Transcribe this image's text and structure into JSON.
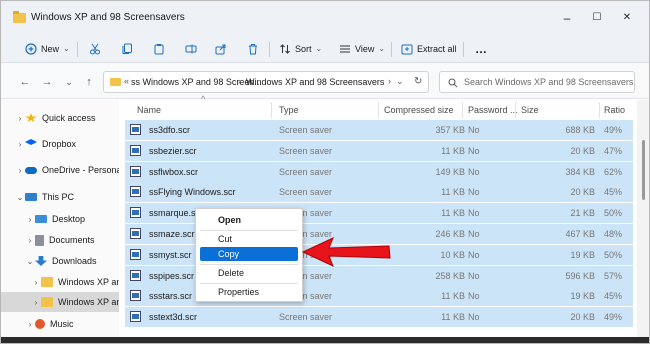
{
  "window": {
    "title": "Windows XP and 98 Screensavers"
  },
  "window_controls": {
    "minimize": "–",
    "maximize": "☐",
    "close": "✕"
  },
  "toolbar": {
    "new_label": "New",
    "sort_label": "Sort",
    "view_label": "View",
    "extract_label": "Extract all",
    "more_label": "…",
    "dropdown_glyph": "⌄"
  },
  "nav": {
    "back": "←",
    "forward": "→",
    "recent": "⌄",
    "up": "↑"
  },
  "addressbar": {
    "overflow": "«",
    "segments": [
      "ss Windows XP and 98 Screen...",
      "Windows XP and 98 Screensavers"
    ],
    "separator": "›",
    "dropdown": "⌄",
    "refresh": "↻"
  },
  "search": {
    "placeholder": "Search Windows XP and 98 Screensavers"
  },
  "sidebar": {
    "items": [
      {
        "label": "Quick access",
        "chevron": "›",
        "icon": "star-icon",
        "color": "#f2b705"
      },
      {
        "label": "Dropbox",
        "chevron": "›",
        "icon": "dropbox-icon",
        "color": "#0061fe"
      },
      {
        "label": "OneDrive - Personal",
        "chevron": "›",
        "icon": "cloud-icon",
        "color": "#0f6cbd"
      },
      {
        "label": "This PC",
        "chevron": "⌄",
        "icon": "computer-icon",
        "color": "#2f7fd1"
      },
      {
        "label": "Desktop",
        "chevron": "›",
        "icon": "desktop-icon",
        "color": "#3b8fd8"
      },
      {
        "label": "Documents",
        "chevron": "›",
        "icon": "documents-icon",
        "color": "#8a8f98"
      },
      {
        "label": "Downloads",
        "chevron": "⌄",
        "icon": "downloads-icon",
        "color": "#2a7bd0"
      },
      {
        "label": "Windows XP and",
        "chevron": "›",
        "icon": "folder-icon",
        "color": "#f3c24a"
      },
      {
        "label": "Windows XP and",
        "chevron": "›",
        "icon": "folder-icon",
        "color": "#f3c24a"
      },
      {
        "label": "Music",
        "chevron": "›",
        "icon": "music-icon",
        "color": "#e05a2b"
      }
    ]
  },
  "table": {
    "sort_glyph": "^",
    "headers": [
      "Name",
      "Type",
      "Compressed size",
      "Password ...",
      "Size",
      "Ratio"
    ],
    "rows": [
      {
        "name": "ss3dfo.scr",
        "type": "Screen saver",
        "compressed": "357 KB",
        "password": "No",
        "size": "688 KB",
        "ratio": "49%"
      },
      {
        "name": "ssbezier.scr",
        "type": "Screen saver",
        "compressed": "11 KB",
        "password": "No",
        "size": "20 KB",
        "ratio": "47%"
      },
      {
        "name": "ssflwbox.scr",
        "type": "Screen saver",
        "compressed": "149 KB",
        "password": "No",
        "size": "384 KB",
        "ratio": "62%"
      },
      {
        "name": "ssFlying Windows.scr",
        "type": "Screen saver",
        "compressed": "11 KB",
        "password": "No",
        "size": "20 KB",
        "ratio": "45%"
      },
      {
        "name": "ssmarque.scr",
        "type": "Screen saver",
        "compressed": "11 KB",
        "password": "No",
        "size": "21 KB",
        "ratio": "50%"
      },
      {
        "name": "ssmaze.scr",
        "type": "Screen saver",
        "compressed": "246 KB",
        "password": "No",
        "size": "467 KB",
        "ratio": "48%"
      },
      {
        "name": "ssmyst.scr",
        "type": "Screen saver",
        "compressed": "10 KB",
        "password": "No",
        "size": "19 KB",
        "ratio": "50%"
      },
      {
        "name": "sspipes.scr",
        "type": "Screen saver",
        "compressed": "258 KB",
        "password": "No",
        "size": "596 KB",
        "ratio": "57%"
      },
      {
        "name": "ssstars.scr",
        "type": "Screen saver",
        "compressed": "11 KB",
        "password": "No",
        "size": "19 KB",
        "ratio": "45%"
      },
      {
        "name": "sstext3d.scr",
        "type": "Screen saver",
        "compressed": "11 KB",
        "password": "No",
        "size": "20 KB",
        "ratio": "49%"
      }
    ]
  },
  "context_menu": {
    "items": [
      {
        "label": "Open",
        "bold": true
      },
      {
        "label": "Cut"
      },
      {
        "label": "Copy",
        "highlighted": true
      },
      {
        "label": "Delete"
      },
      {
        "label": "Properties"
      }
    ]
  },
  "annotation": {
    "color": "#e8141c",
    "icon": "red-arrow-icon"
  },
  "colors": {
    "selection": "#cce4f7",
    "menu_highlight": "#0a6fd6",
    "toolbar_bg": "#eef2f7"
  }
}
